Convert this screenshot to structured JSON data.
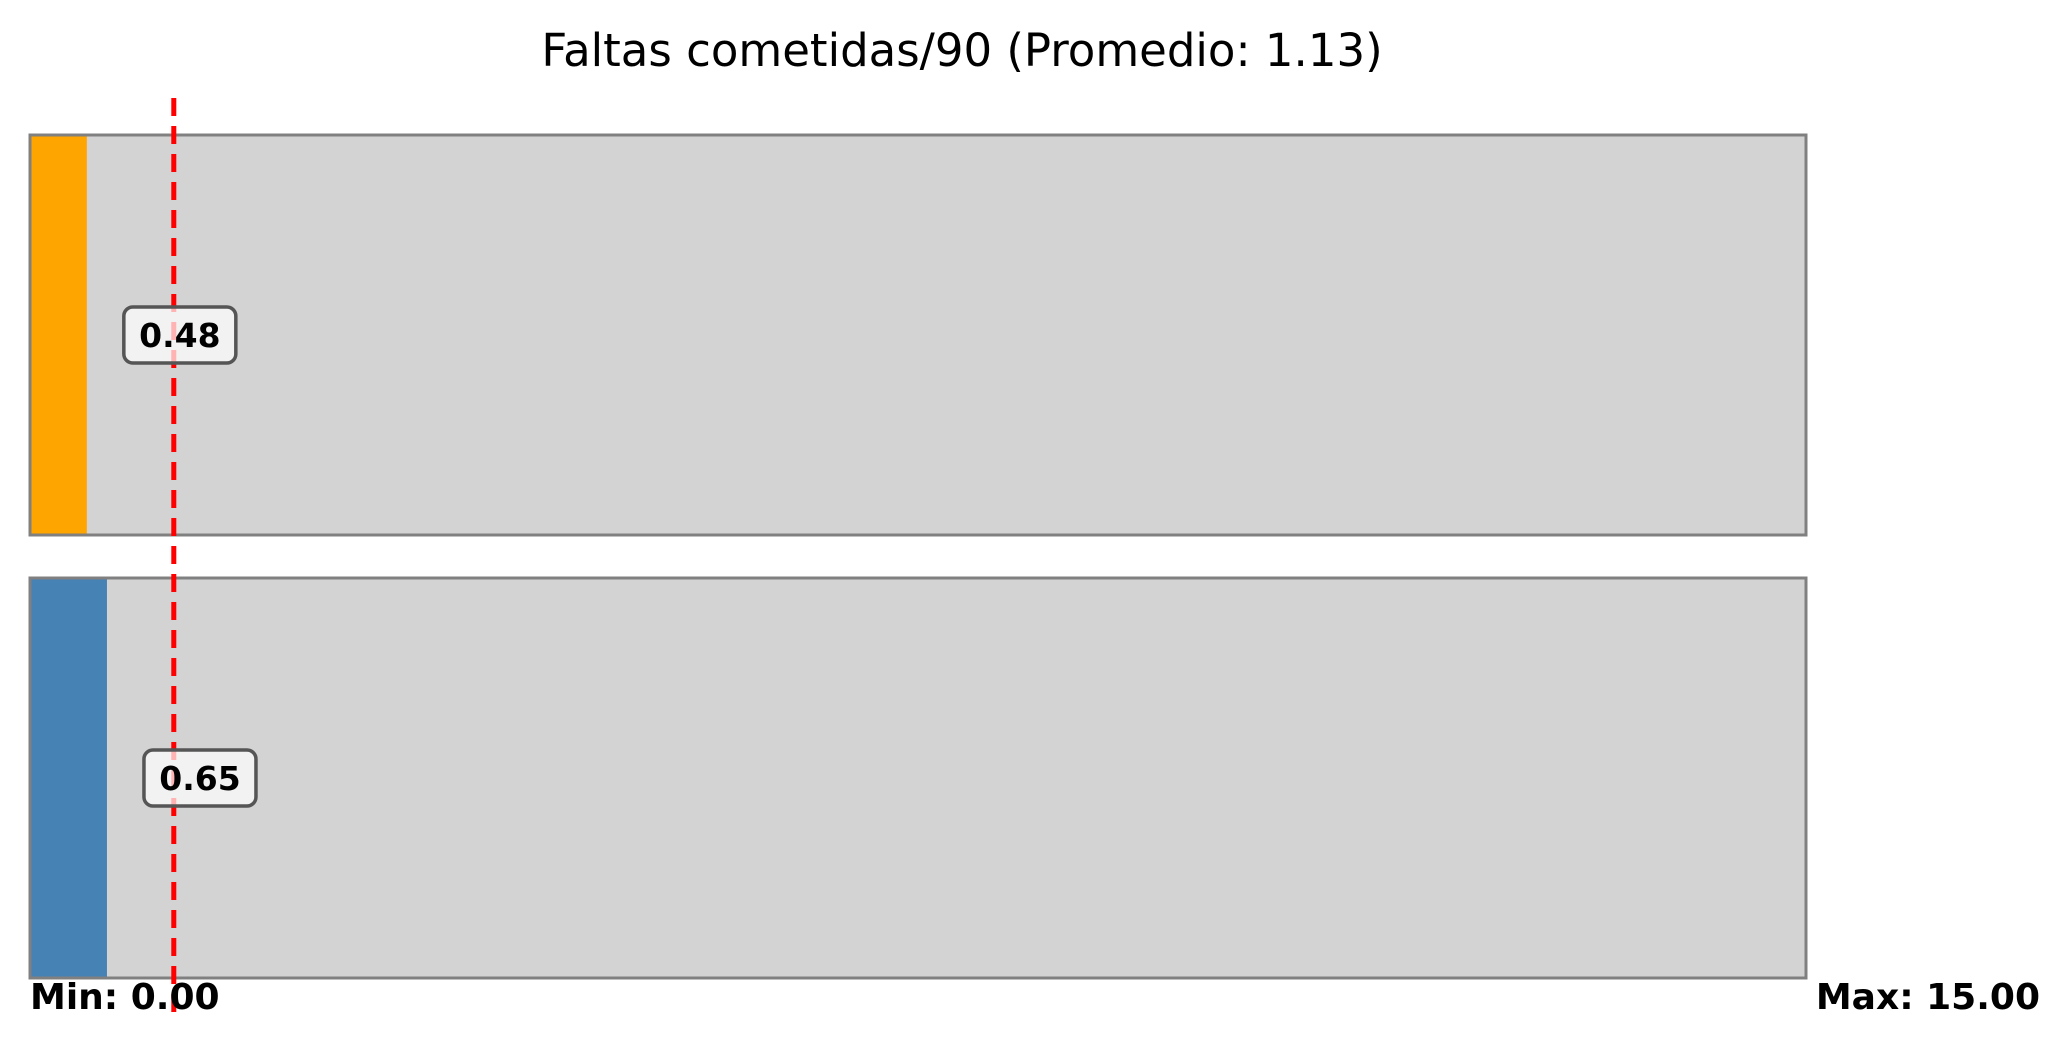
{
  "chart_data": {
    "type": "bar",
    "orientation": "horizontal",
    "title": "Faltas cometidas/90 (Promedio: 1.13)",
    "xlim": [
      0,
      15
    ],
    "min_label": "Min: 0.00",
    "max_label": "Max: 15.00",
    "average": 1.13,
    "grid": false,
    "series": [
      {
        "value": 0.48,
        "label": "0.48",
        "color": "#FFA500"
      },
      {
        "value": 0.65,
        "label": "0.65",
        "color": "#4682B4"
      }
    ],
    "track_color": "#D3D3D3",
    "track_border_color": "#808080",
    "average_line_color": "#FF0000"
  }
}
